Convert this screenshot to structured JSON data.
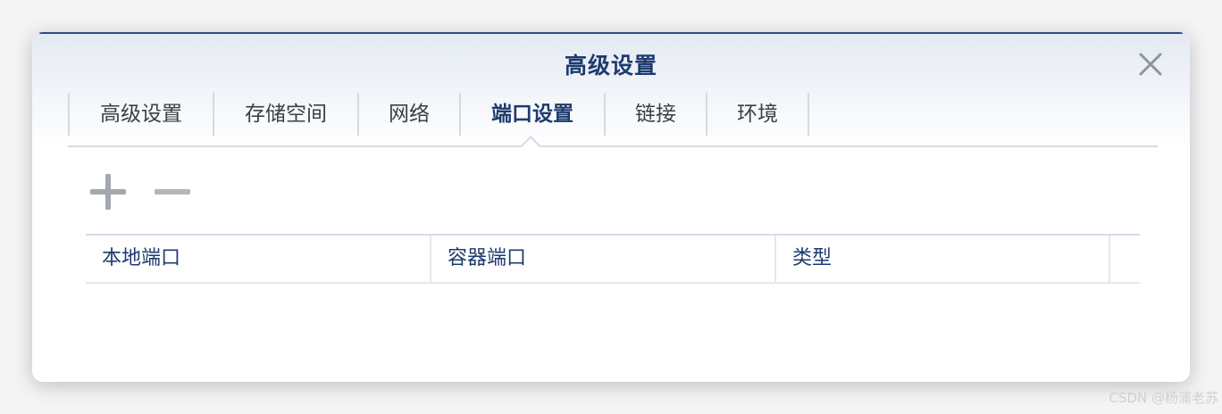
{
  "dialog": {
    "title": "高级设置",
    "close_icon": "close-icon"
  },
  "tabs": [
    {
      "label": "高级设置",
      "active": false
    },
    {
      "label": "存储空间",
      "active": false
    },
    {
      "label": "网络",
      "active": false
    },
    {
      "label": "端口设置",
      "active": true
    },
    {
      "label": "链接",
      "active": false
    },
    {
      "label": "环境",
      "active": false
    }
  ],
  "toolbar": {
    "add_icon": "plus-icon",
    "remove_icon": "minus-icon"
  },
  "table": {
    "columns": [
      "本地端口",
      "容器端口",
      "类型"
    ],
    "rows": []
  },
  "watermark": "CSDN @杨浦老苏",
  "colors": {
    "title": "#1e3b6e",
    "tab_text": "#3b3f46",
    "tab_active": "#1e3b6e",
    "header_accent": "#2a4c86",
    "icon_gray": "#a4a8ae"
  }
}
